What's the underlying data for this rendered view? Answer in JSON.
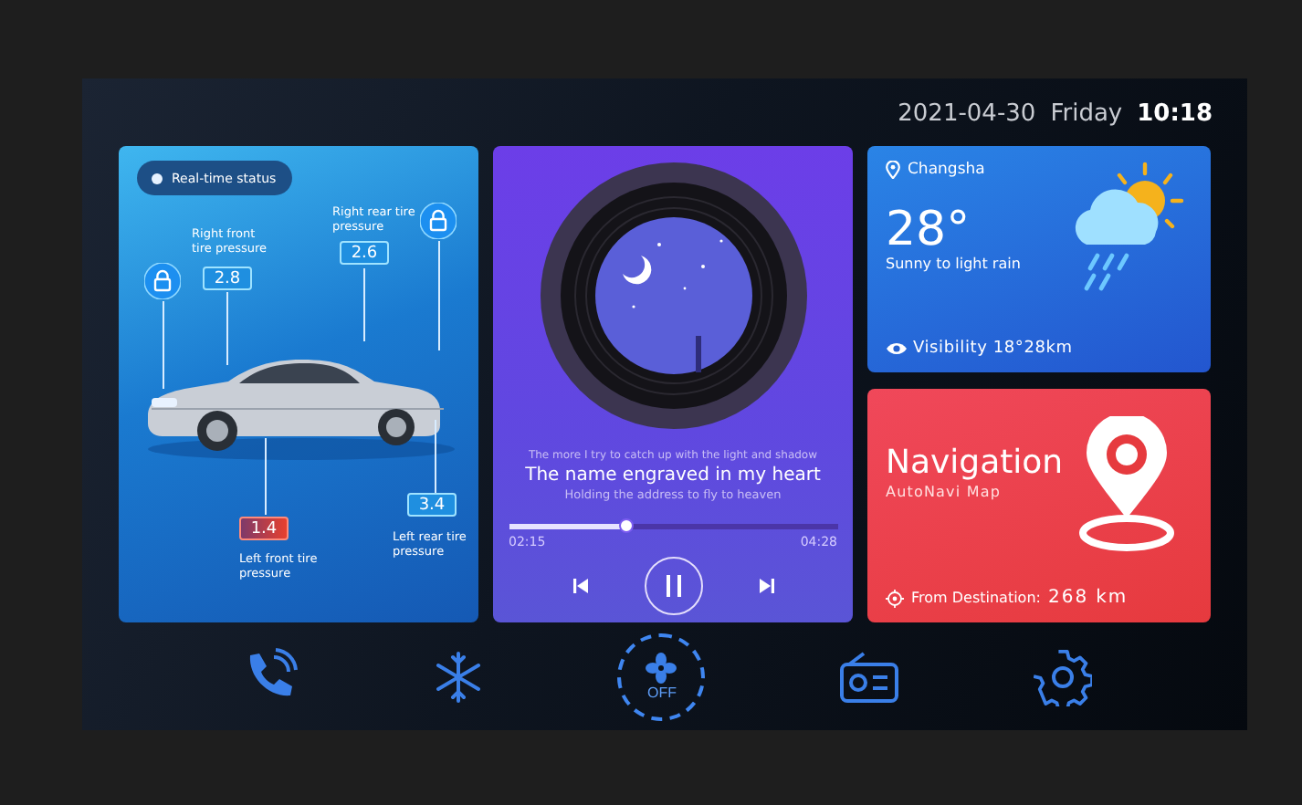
{
  "header": {
    "date": "2021-04-30",
    "weekday": "Friday",
    "time": "10:18"
  },
  "car_status": {
    "badge": "Real-time status",
    "tires": [
      {
        "label": "Right front tire pressure",
        "value": "2.8",
        "alert": false
      },
      {
        "label": "Right rear tire pressure",
        "value": "2.6",
        "alert": false
      },
      {
        "label": "Left front tire pressure",
        "value": "1.4",
        "alert": true
      },
      {
        "label": "Left rear tire pressure",
        "value": "3.4",
        "alert": false
      }
    ],
    "locks": [
      {
        "locked": true
      },
      {
        "locked": true
      }
    ]
  },
  "music": {
    "lyric_before": "The more I try to catch up with the light and shadow",
    "title": "The name engraved in my heart",
    "lyric_after": "Holding the address to fly to heaven",
    "level": 0.36,
    "elapsed": "02:15",
    "total": "04:28",
    "playing": true
  },
  "weather": {
    "city": "Changsha",
    "temperature": "28°",
    "condition": "Sunny to light rain",
    "visibility": "Visibility 18°28km"
  },
  "navigation": {
    "title": "Navigation",
    "subtitle": "AutoNavi Map",
    "distance_label": "From Destination:",
    "distance": "268",
    "unit": "km"
  },
  "dock": {
    "fan_label": "OFF"
  }
}
